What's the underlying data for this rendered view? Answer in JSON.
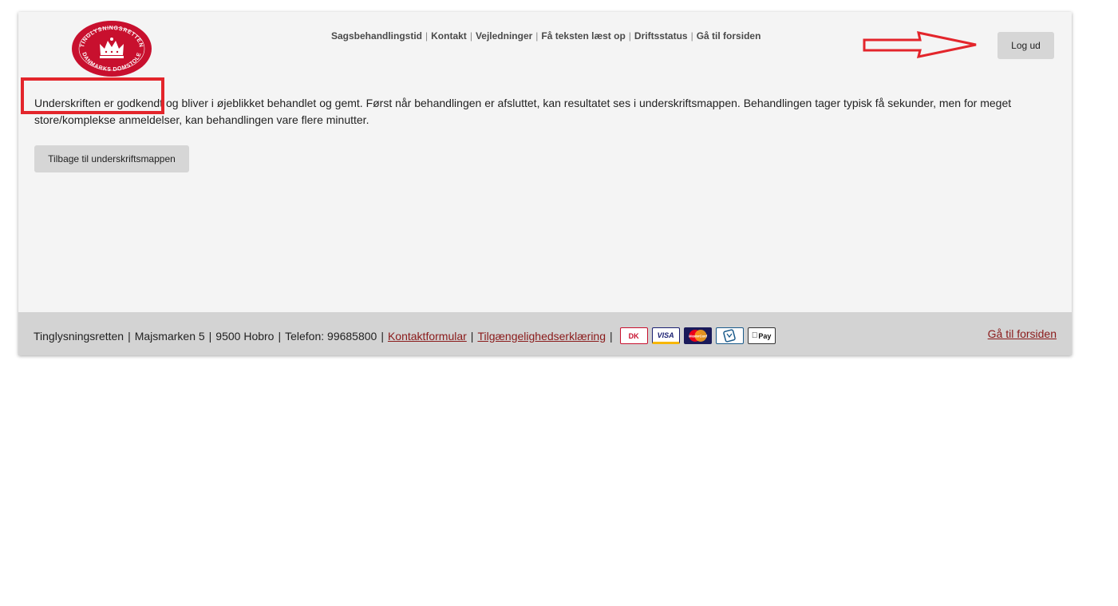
{
  "header": {
    "logo_alt_text": "TINGLYSNINGSRETTEN DANMARKS DOMSTOLE",
    "nav": [
      {
        "label": "Sagsbehandlingstid"
      },
      {
        "label": "Kontakt"
      },
      {
        "label": "Vejledninger"
      },
      {
        "label": "Få teksten læst op"
      },
      {
        "label": "Driftsstatus"
      },
      {
        "label": "Gå til forsiden"
      }
    ],
    "nav_separator": "|",
    "logout_label": "Log ud"
  },
  "main": {
    "message": "Underskriften er godkendt og bliver i øjeblikket behandlet og gemt. Først når behandlingen er afsluttet, kan resultatet ses i underskriftsmappen. Behandlingen tager typisk få sekunder, men for meget store/komplekse anmeldelser, kan behandlingen vare flere minutter.",
    "back_button_label": "Tilbage til underskriftsmappen"
  },
  "annotations": {
    "highlight_color": "#e3252b",
    "arrow_color": "#e3252b"
  },
  "footer": {
    "org": "Tinglysningsretten",
    "address": "Majsmarken 5",
    "city": "9500 Hobro",
    "phone": "Telefon: 99685800",
    "contact_link": "Kontaktformular",
    "accessibility_link": "Tilgængelighedserklæring",
    "separator": "|",
    "payment_icons": [
      {
        "icon": "dankort-icon",
        "text": "DK"
      },
      {
        "icon": "visa-icon",
        "text": "VISA"
      },
      {
        "icon": "mastercard-icon",
        "text": "MasterCard"
      },
      {
        "icon": "mobilepay-icon",
        "text": ""
      },
      {
        "icon": "apple-pay-icon",
        "text": "Pay"
      }
    ],
    "home_link": "Gå til forsiden"
  },
  "colors": {
    "brand_red": "#c8102e",
    "link_color": "#8a1a1a",
    "page_bg": "#f4f4f4",
    "footer_bg": "#d3d3d3"
  }
}
